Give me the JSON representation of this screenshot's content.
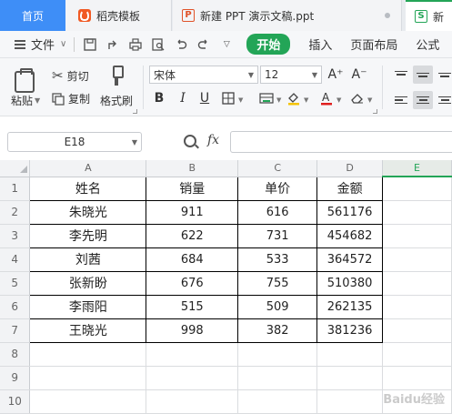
{
  "tabs": {
    "home": "首页",
    "docer": "稻壳模板",
    "ppt": "新建 PPT 演示文稿.ppt",
    "sheet": "新"
  },
  "menu": {
    "file": "文件",
    "start": "开始",
    "insert": "插入",
    "layout": "页面布局",
    "formula": "公式"
  },
  "ribbon": {
    "paste": "粘贴",
    "cut": "剪切",
    "copy": "复制",
    "format_painter": "格式刷",
    "font_name": "宋体",
    "font_size": "12",
    "font_grow": "A⁺",
    "font_shrink": "A⁻",
    "bold": "B",
    "italic": "I",
    "underline": "U"
  },
  "formula_bar": {
    "name_box": "E18",
    "fx": "fx",
    "value": ""
  },
  "sheet": {
    "columns": [
      "A",
      "B",
      "C",
      "D",
      "E"
    ],
    "rows": [
      "1",
      "2",
      "3",
      "4",
      "5",
      "6",
      "7",
      "8",
      "9",
      "10"
    ],
    "header": [
      "姓名",
      "销量",
      "单价",
      "金额"
    ],
    "data": [
      [
        "朱晓光",
        "911",
        "616",
        "561176"
      ],
      [
        "李先明",
        "622",
        "731",
        "454682"
      ],
      [
        "刘茜",
        "684",
        "533",
        "364572"
      ],
      [
        "张新盼",
        "676",
        "755",
        "510380"
      ],
      [
        "李雨阳",
        "515",
        "509",
        "262135"
      ],
      [
        "王晓光",
        "998",
        "382",
        "381236"
      ]
    ]
  },
  "watermark": "Baidu经验",
  "colors": {
    "accent_green": "#23a557",
    "home_tab_blue": "#3e8ef7"
  }
}
